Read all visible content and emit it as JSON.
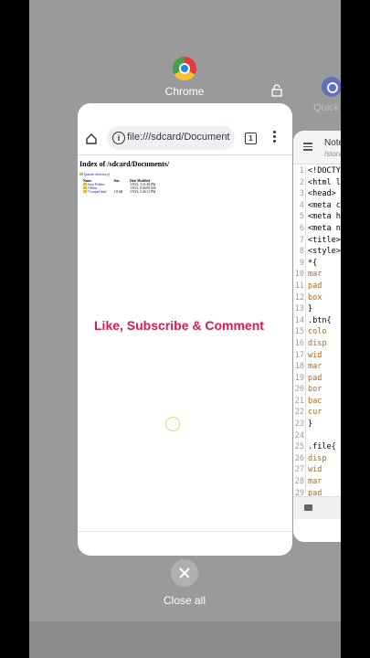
{
  "apps": {
    "chrome_label": "Chrome",
    "second_label": "Quick"
  },
  "chrome_card": {
    "url": "file:///sdcard/Document",
    "tab_count": "1",
    "index_title": "Index of /sdcard/Documents/",
    "parent_link": "[parent directory]",
    "columns": [
      "Name",
      "Size",
      "Date Modified"
    ],
    "rows": [
      {
        "name": "Save Folders",
        "size": "",
        "date": "1/9/23, 3:31:48 PM"
      },
      {
        "name": "Offline",
        "size": "",
        "date": "1/9/23, 8:56:09 AM"
      },
      {
        "name": "Vconpad.html",
        "size": "1.8 kB",
        "date": "1/9/23, 2:26:13 PM"
      }
    ],
    "overlay_text": "Like, Subscribe & Comment"
  },
  "editor_card": {
    "title": "Note",
    "path": "/stora",
    "lines": [
      {
        "n": "1",
        "t": "<!DOCTY"
      },
      {
        "n": "2",
        "t": "<html la"
      },
      {
        "n": "3",
        "t": "<head>"
      },
      {
        "n": "4",
        "t": "<meta c"
      },
      {
        "n": "5",
        "t": "<meta h"
      },
      {
        "n": "6",
        "t": "<meta n"
      },
      {
        "n": "7",
        "t": "<title>N"
      },
      {
        "n": "8",
        "t": "<style>"
      },
      {
        "n": "9",
        "t": "  *{"
      },
      {
        "n": "10",
        "t": "    mar"
      },
      {
        "n": "11",
        "t": "    pad"
      },
      {
        "n": "12",
        "t": "    box"
      },
      {
        "n": "13",
        "t": "  }"
      },
      {
        "n": "14",
        "t": "  .btn{"
      },
      {
        "n": "15",
        "t": "    colo"
      },
      {
        "n": "16",
        "t": "    disp"
      },
      {
        "n": "17",
        "t": "    wid"
      },
      {
        "n": "18",
        "t": "    mar"
      },
      {
        "n": "19",
        "t": "    pad"
      },
      {
        "n": "20",
        "t": "    bor"
      },
      {
        "n": "21",
        "t": "    bac"
      },
      {
        "n": "22",
        "t": "    cur"
      },
      {
        "n": "23",
        "t": "  }"
      },
      {
        "n": "24",
        "t": ""
      },
      {
        "n": "25",
        "t": "  .file{"
      },
      {
        "n": "26",
        "t": "    disp"
      },
      {
        "n": "27",
        "t": "    wid"
      },
      {
        "n": "28",
        "t": "    mar"
      },
      {
        "n": "29",
        "t": "    pad"
      }
    ]
  },
  "close_all_label": "Close all"
}
